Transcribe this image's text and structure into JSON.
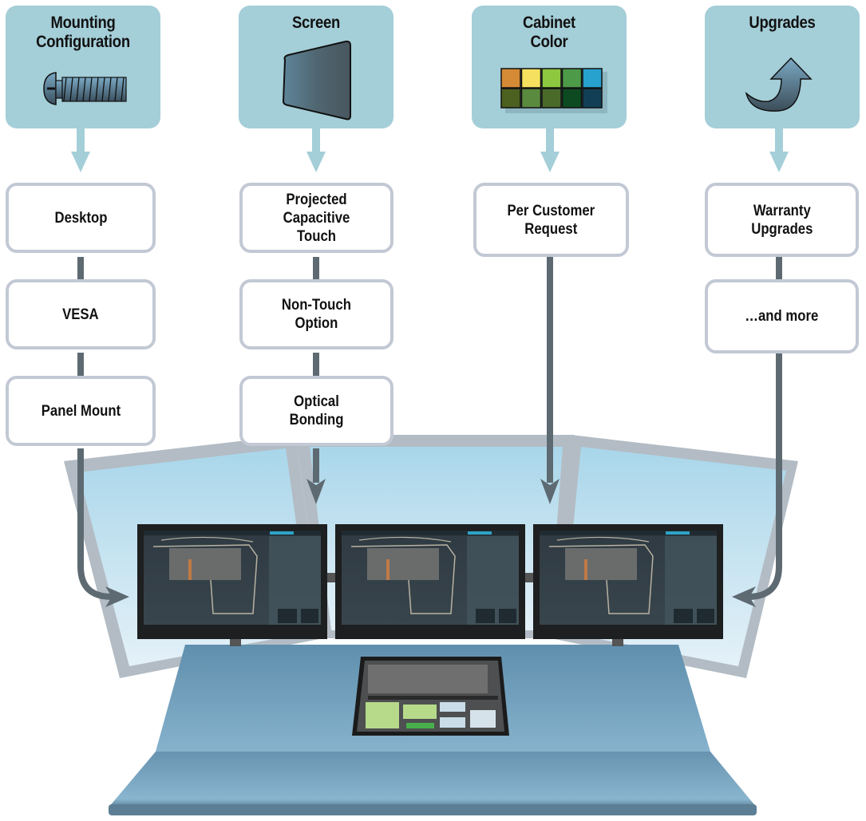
{
  "categories": [
    {
      "title": "Mounting\nConfiguration",
      "icon": "screw-icon",
      "options": [
        "Desktop",
        "VESA",
        "Panel Mount"
      ]
    },
    {
      "title": "Screen",
      "icon": "display-panel-icon",
      "options": [
        "Projected Capacitive\nTouch",
        "Non-Touch\nOption",
        "Optical\nBonding"
      ]
    },
    {
      "title": "Cabinet\nColor",
      "icon": "color-swatch-icon",
      "swatches": [
        "#d58a35",
        "#f5e15f",
        "#8dc840",
        "#4d9a48",
        "#27a2cf",
        "#4c6120",
        "#5a8a3e",
        "#4a6a2a",
        "#0d4a22",
        "#123f55"
      ],
      "options": [
        "Per Customer\nRequest"
      ]
    },
    {
      "title": "Upgrades",
      "icon": "upgrade-arrow-icon",
      "options": [
        "Warranty\nUpgrades",
        "…and more"
      ]
    }
  ],
  "colors": {
    "category_bg": "#a4ced8",
    "option_border": "#c2c9d4",
    "connector": "#5e6a72",
    "desk": "#6a9ab8",
    "window_frame": "#b3bcc4",
    "window_glass": "#b8dcec"
  },
  "console": {
    "monitors": [
      "left-monitor",
      "center-monitor",
      "right-monitor"
    ],
    "touch_panel": "console-touch-panel"
  }
}
